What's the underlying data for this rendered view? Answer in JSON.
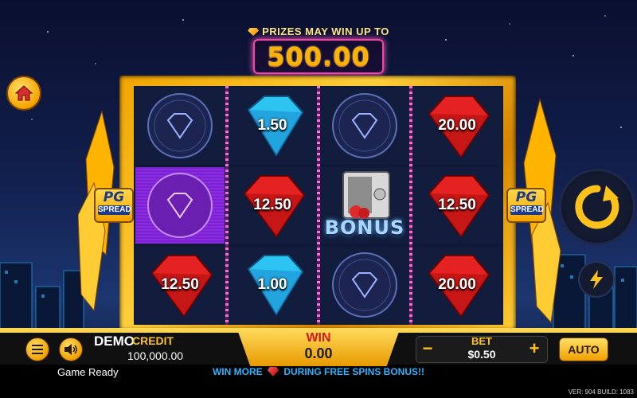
{
  "header": {
    "prize_label": "PRIZES MAY WIN UP TO",
    "prize_value": "500.00"
  },
  "side": {
    "left_badge": {
      "logo": "PG",
      "label": "SPREAD"
    },
    "right_badge": {
      "logo": "PG",
      "label": "SPREAD"
    }
  },
  "reels": [
    [
      {
        "symbol": "diamond-medallion",
        "value": ""
      },
      {
        "symbol": "diamond-medallion",
        "value": "",
        "highlighted": true
      },
      {
        "symbol": "red-gem",
        "value": "12.50"
      }
    ],
    [
      {
        "symbol": "blue-gem",
        "value": "1.50"
      },
      {
        "symbol": "red-gem",
        "value": "12.50"
      },
      {
        "symbol": "blue-gem",
        "value": "1.00"
      }
    ],
    [
      {
        "symbol": "diamond-medallion",
        "value": ""
      },
      {
        "symbol": "bonus-safe",
        "value": "BONUS"
      },
      {
        "symbol": "diamond-medallion",
        "value": ""
      }
    ],
    [
      {
        "symbol": "red-gem",
        "value": "20.00"
      },
      {
        "symbol": "red-gem",
        "value": "12.50"
      },
      {
        "symbol": "red-gem",
        "value": "20.00"
      }
    ]
  ],
  "bar": {
    "demo_label": "DEMO",
    "credit_label": "CREDIT",
    "credit_value": "100,000.00",
    "win_label": "WIN",
    "win_value": "0.00",
    "bet_minus": "−",
    "bet_plus": "+",
    "bet_label": "BET",
    "bet_value": "$0.50",
    "auto_label": "AUTO"
  },
  "footer": {
    "status": "Game Ready",
    "promo_before": "WIN MORE",
    "promo_after": "DURING FREE SPINS BONUS!!",
    "version": "VER: 904  BUILD: 1083"
  },
  "icons": [
    "home-icon",
    "menu-icon",
    "sound-icon",
    "spin-icon",
    "turbo-icon"
  ],
  "colors": {
    "gold": "#ffc21a",
    "win_red": "#d11a1a",
    "promo_blue": "#2bb3ff",
    "neon_pink": "#ff3fa8"
  }
}
